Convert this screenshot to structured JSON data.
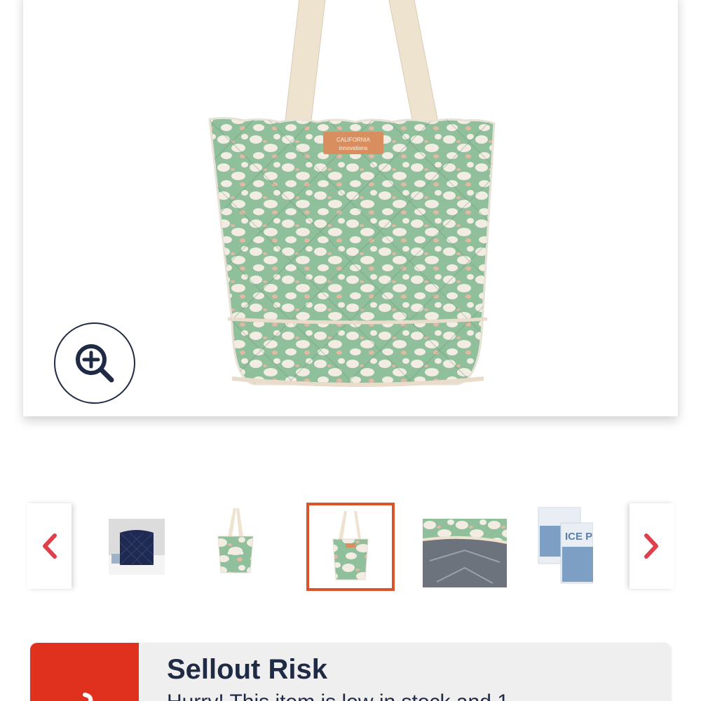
{
  "product": {
    "main_image": {
      "alt": "Green leopard print quilted tote cooler bag",
      "brand_patch": [
        "CALIFORNIA",
        "innovations"
      ]
    },
    "zoom_icon": "zoom-in-icon"
  },
  "carousel": {
    "prev_icon": "chevron-left-icon",
    "next_icon": "chevron-right-icon",
    "thumbnails": [
      {
        "alt": "Navy quilted cooler bag"
      },
      {
        "alt": "Leopard tote front view"
      },
      {
        "alt": "Leopard tote product view",
        "selected": true
      },
      {
        "alt": "Insulated interior lining"
      },
      {
        "alt": "Ice pack accessories",
        "text": "ICE P"
      }
    ]
  },
  "alert": {
    "title": "Sellout Risk",
    "message": "Hurry! This item is low in stock and 1…",
    "icon": "alert-icon"
  },
  "colors": {
    "accent": "#e0301e",
    "selected_border": "#d9542b",
    "text_dark": "#1f2a44",
    "arrow_red": "#e0404a"
  }
}
